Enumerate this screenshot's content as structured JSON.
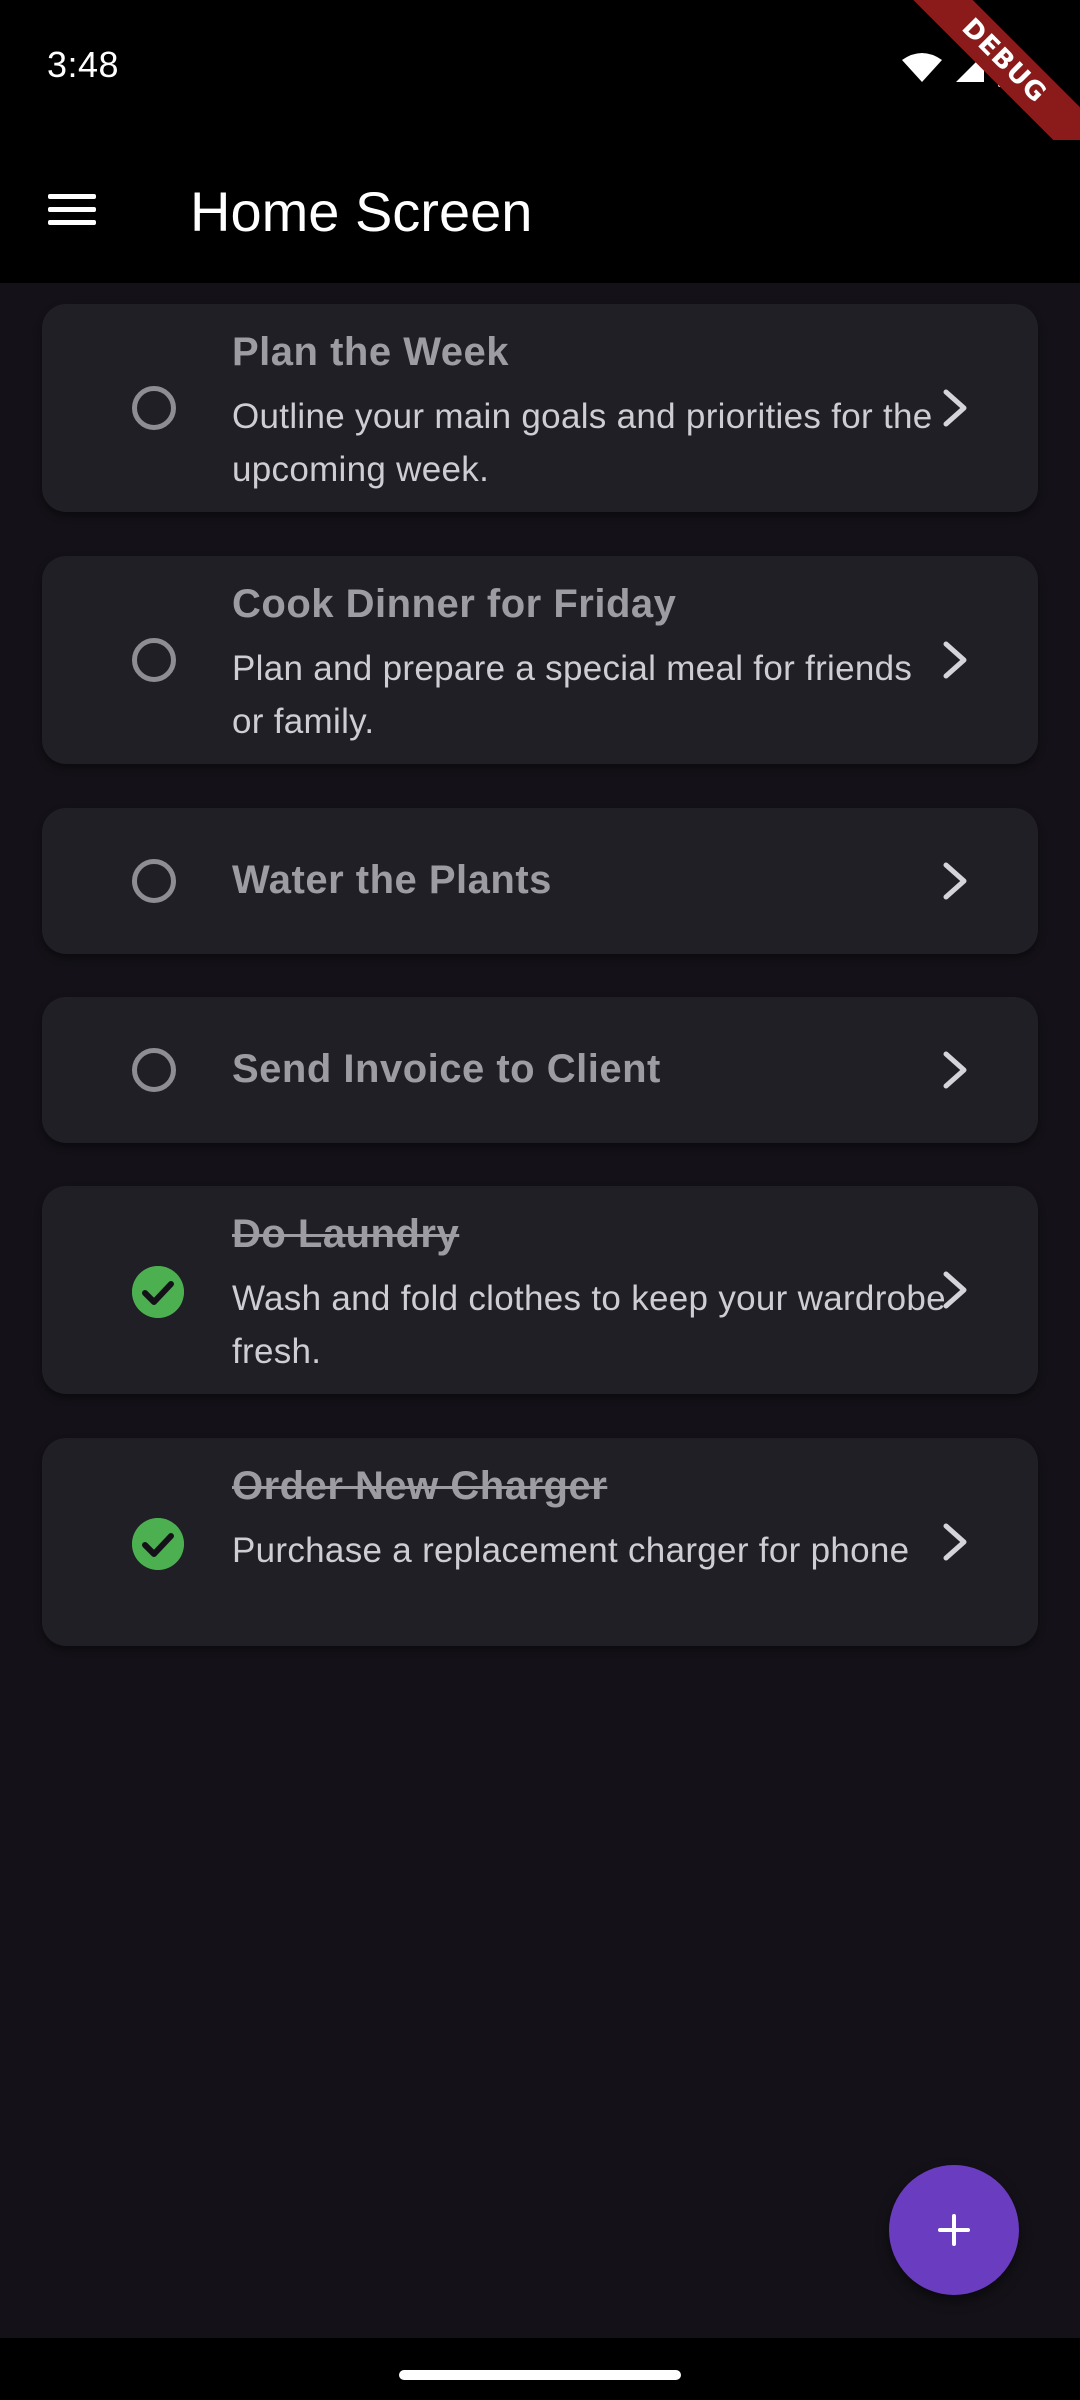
{
  "status_bar": {
    "time": "3:48",
    "icons": [
      "wifi-icon",
      "cell-signal-icon",
      "battery-icon"
    ],
    "debug_label": "DEBUG"
  },
  "app_bar": {
    "title": "Home Screen",
    "menu_icon": "menu-icon"
  },
  "tasks": [
    {
      "title": "Plan the Week",
      "description": "Outline your main goals and priorities for the upcoming week.",
      "completed": false
    },
    {
      "title": "Cook Dinner for Friday",
      "description": "Plan and prepare a special meal for friends or family.",
      "completed": false
    },
    {
      "title": "Water the Plants",
      "description": "",
      "completed": false
    },
    {
      "title": "Send Invoice to Client",
      "description": "",
      "completed": false
    },
    {
      "title": "Do Laundry",
      "description": "Wash and fold clothes to keep your wardrobe fresh.",
      "completed": true
    },
    {
      "title": "Order New Charger",
      "description": "Purchase a replacement charger for phone",
      "completed": true
    }
  ],
  "fab": {
    "icon": "plus-icon"
  },
  "colors": {
    "background": "#141218",
    "card": "#211f26",
    "accent": "#6a3cc0",
    "done": "#4caf50"
  }
}
